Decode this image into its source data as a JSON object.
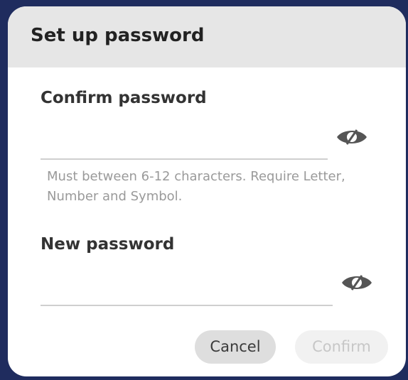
{
  "dialog": {
    "title": "Set up password"
  },
  "confirm_password": {
    "label": "Confirm password",
    "value": "",
    "visibility_icon": "eye-slash-icon"
  },
  "hint": {
    "text": "Must between 6-12 characters. Require Letter, Number and Symbol."
  },
  "new_password": {
    "label": "New password",
    "value": "",
    "visibility_icon": "eye-slash-icon"
  },
  "actions": {
    "cancel_label": "Cancel",
    "confirm_label": "Confirm",
    "confirm_enabled": false
  },
  "colors": {
    "backdrop": "#1f2c5e",
    "header_bg": "#e6e6e6",
    "cancel_bg": "#dedede",
    "confirm_disabled_bg": "#f1f1f1",
    "icon": "#555555"
  }
}
